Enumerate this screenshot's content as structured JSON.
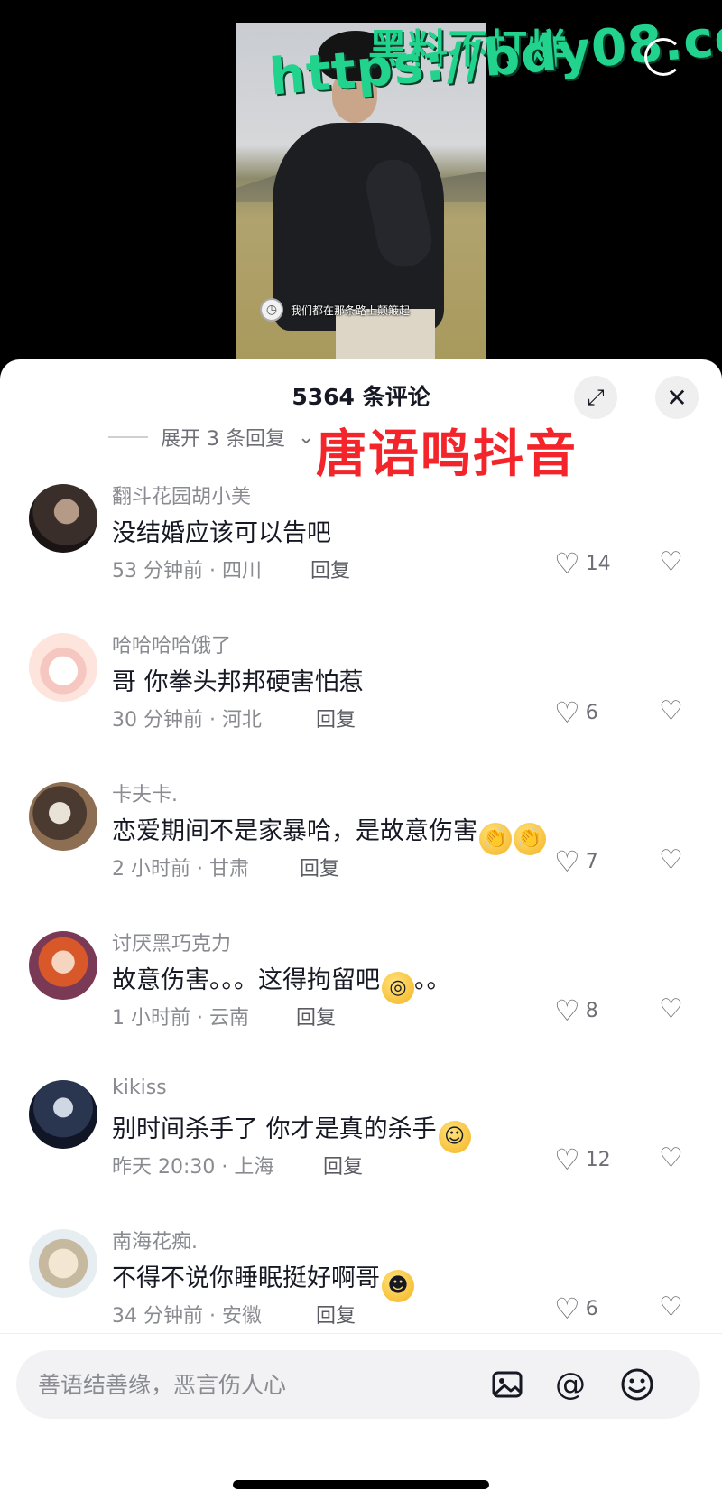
{
  "video": {
    "subtitle": "我们都在那条路上颠簸起",
    "watermark_line1": "黑料不打烊",
    "watermark_line2": "https://bdy08.com"
  },
  "sheet": {
    "title": "5364 条评论",
    "expand_replies": "展开 3 条回复",
    "red_watermark": "唐语鸣抖音"
  },
  "comments": [
    {
      "user": "翻斗花园胡小美",
      "text": "没结婚应该可以告吧",
      "time": "53 分钟前 · 四川",
      "reply": "回复",
      "likes": "14"
    },
    {
      "user": "哈哈哈哈饿了",
      "text": "哥 你拳头邦邦硬害怕惹",
      "time": "30 分钟前 · 河北",
      "reply": "回复",
      "likes": "6"
    },
    {
      "user": "卡夫卡.",
      "text": "恋爱期间不是家暴哈，是故意伤害",
      "time": "2 小时前 · 甘肃",
      "reply": "回复",
      "likes": "7"
    },
    {
      "user": "讨厌黑巧克力",
      "text": "故意伤害。。。这得拘留吧",
      "text_tail": "。。",
      "time": "1 小时前 · 云南",
      "reply": "回复",
      "likes": "8"
    },
    {
      "user": "kikiss",
      "text": "别时间杀手了 你才是真的杀手",
      "time": "昨天 20:30 · 上海",
      "reply": "回复",
      "likes": "12"
    },
    {
      "user": "南海花痴.",
      "text": "不得不说你睡眠挺好啊哥",
      "time": "34 分钟前 · 安徽",
      "reply": "回复",
      "likes": "6"
    }
  ],
  "input": {
    "placeholder": "善语结善缘，恶言伤人心"
  },
  "icons": {
    "image": "image-icon",
    "at": "at-icon",
    "emoji": "emoji-icon",
    "like": "heart-icon",
    "dislike": "broken-heart-icon",
    "close": "close-icon",
    "expand": "expand-icon",
    "rotate": "rotate-icon"
  },
  "colors": {
    "watermark_green": "#22d38e",
    "watermark_red": "#f3242a",
    "text_primary": "#161823",
    "text_secondary": "#8a8b91"
  }
}
